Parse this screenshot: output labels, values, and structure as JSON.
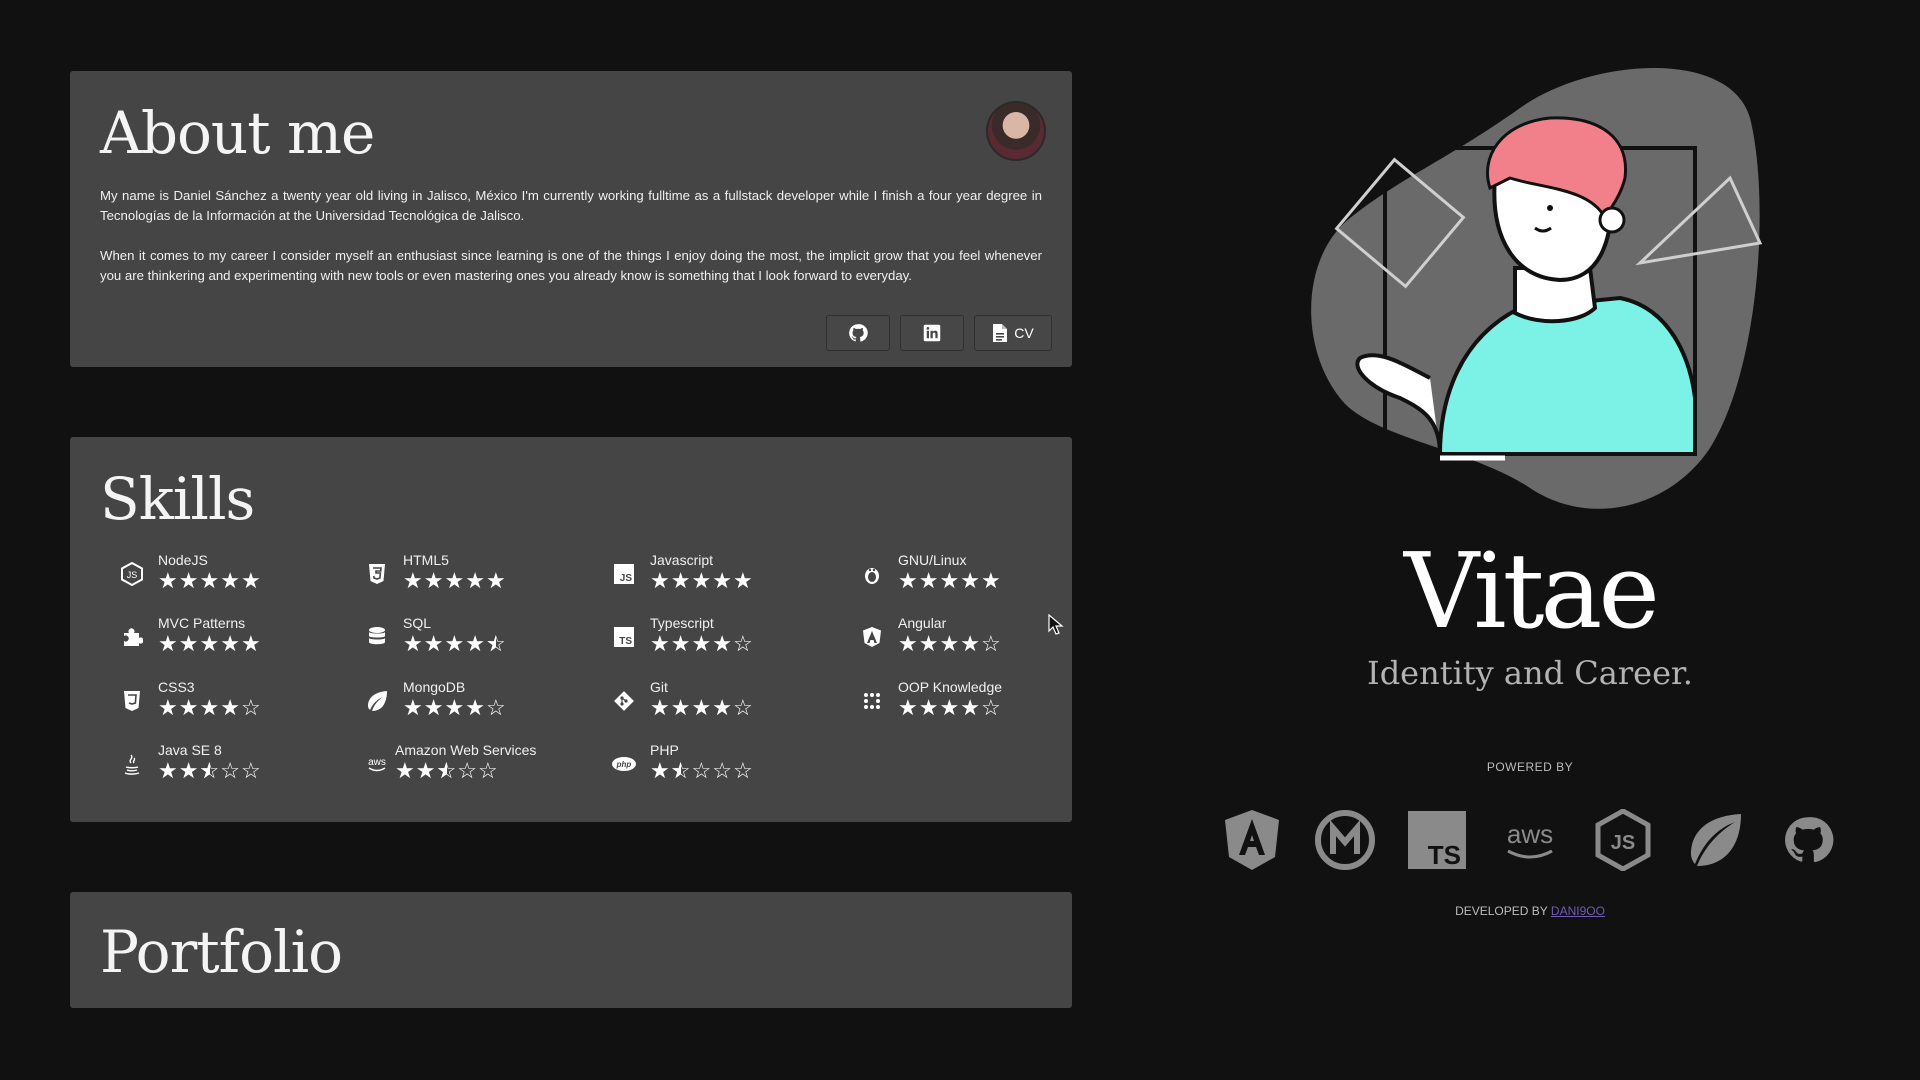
{
  "about": {
    "title": "About me",
    "paragraph1": "My name is Daniel Sánchez a twenty year old living in Jalisco, México I'm currently working fulltime as a fullstack developer while I finish a four year degree in Tecnologías de la Información at the Universidad Tecnológica de Jalisco.",
    "paragraph2": "When it comes to my career I consider myself an enthusiast since learning is one of the things I enjoy doing the most, the implicit grow that you feel whenever you are thinkering and experimenting with new tools or even mastering ones you already know is something that I look forward to everyday.",
    "buttons": {
      "github_icon": "github-icon",
      "linkedin_icon": "linkedin-icon",
      "cv_label": "CV",
      "cv_icon": "file-icon"
    }
  },
  "skills": {
    "title": "Skills",
    "items": [
      {
        "name": "NodeJS",
        "rating": 5,
        "icon": "nodejs-icon"
      },
      {
        "name": "HTML5",
        "rating": 5,
        "icon": "html5-icon"
      },
      {
        "name": "Javascript",
        "rating": 5,
        "icon": "javascript-icon"
      },
      {
        "name": "GNU/Linux",
        "rating": 5,
        "icon": "linux-icon"
      },
      {
        "name": "MVC Patterns",
        "rating": 5,
        "icon": "puzzle-icon"
      },
      {
        "name": "SQL",
        "rating": 4.5,
        "icon": "database-icon"
      },
      {
        "name": "Typescript",
        "rating": 4,
        "icon": "typescript-icon"
      },
      {
        "name": "Angular",
        "rating": 4,
        "icon": "angular-icon"
      },
      {
        "name": "CSS3",
        "rating": 4,
        "icon": "css3-icon"
      },
      {
        "name": "MongoDB",
        "rating": 4,
        "icon": "leaf-icon"
      },
      {
        "name": "Git",
        "rating": 4,
        "icon": "git-icon"
      },
      {
        "name": "OOP Knowledge",
        "rating": 4,
        "icon": "grid-dots-icon"
      },
      {
        "name": "Java SE 8",
        "rating": 2.5,
        "icon": "java-icon"
      },
      {
        "name": "Amazon Web Services",
        "rating": 2.5,
        "icon": "aws-icon"
      },
      {
        "name": "PHP",
        "rating": 1.5,
        "icon": "php-icon"
      }
    ]
  },
  "portfolio": {
    "title": "Portfolio"
  },
  "hero": {
    "title": "Vitae",
    "tagline": "Identity and Career.",
    "powered_by": "POWERED BY",
    "tech_icons": [
      "angular-icon",
      "materialize-icon",
      "typescript-icon",
      "aws-icon",
      "nodejs-icon",
      "mongodb-leaf-icon",
      "github-icon"
    ],
    "tech_labels": {
      "ts": "TS",
      "aws": "aws",
      "js": "JS"
    },
    "developed_by": "DEVELOPED BY",
    "developer": "DANI9OO"
  },
  "colors": {
    "background": "#111112",
    "card": "#454545",
    "accent_link": "#6f5ab4",
    "illustration_hair": "#f2808a",
    "illustration_shirt": "#7cf2e6"
  }
}
